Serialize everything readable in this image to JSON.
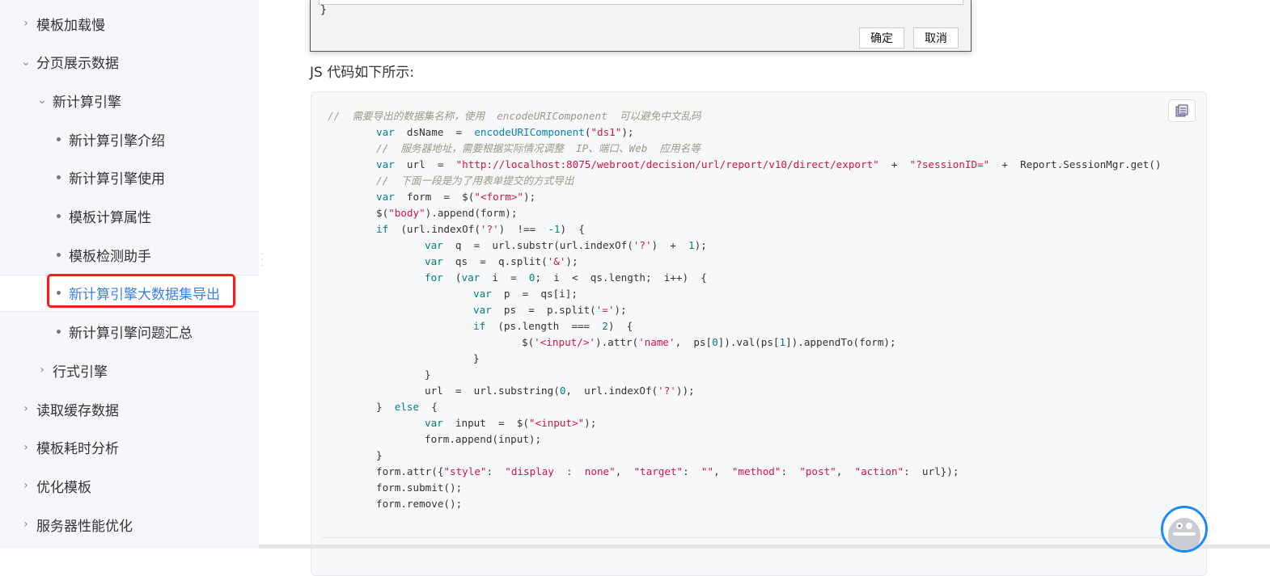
{
  "sidebar": {
    "items": [
      {
        "label": "模板加载慢",
        "level": 0,
        "type": "collapsed"
      },
      {
        "label": "分页展示数据",
        "level": 0,
        "type": "expanded"
      },
      {
        "label": "新计算引擎",
        "level": 1,
        "type": "expanded"
      },
      {
        "label": "新计算引擎介绍",
        "level": 2,
        "type": "leaf"
      },
      {
        "label": "新计算引擎使用",
        "level": 2,
        "type": "leaf"
      },
      {
        "label": "模板计算属性",
        "level": 2,
        "type": "leaf"
      },
      {
        "label": "模板检测助手",
        "level": 2,
        "type": "leaf"
      },
      {
        "label": "新计算引擎大数据集导出",
        "level": 2,
        "type": "leaf",
        "active": true
      },
      {
        "label": "新计算引擎问题汇总",
        "level": 2,
        "type": "leaf"
      },
      {
        "label": "行式引擎",
        "level": 1,
        "type": "collapsed"
      },
      {
        "label": "读取缓存数据",
        "level": 0,
        "type": "collapsed"
      },
      {
        "label": "模板耗时分析",
        "level": 0,
        "type": "collapsed"
      },
      {
        "label": "优化模板",
        "level": 0,
        "type": "collapsed"
      },
      {
        "label": "服务器性能优化",
        "level": 0,
        "type": "collapsed"
      }
    ]
  },
  "dialog": {
    "brace": "}",
    "ok_label": "确定",
    "cancel_label": "取消"
  },
  "content": {
    "js_label": "JS 代码如下所示:"
  },
  "colors": {
    "accent": "#3d7fe0",
    "highlight_box": "#ff1a1a",
    "keyword": "#008080",
    "string": "#dd1144",
    "comment": "#999988",
    "function": "#0086b3"
  },
  "code": [
    {
      "indent": 0,
      "tokens": [
        [
          "c",
          "//  需要导出的数据集名称，使用  encodeURIComponent  可以避免中文乱码"
        ]
      ]
    },
    {
      "indent": 1,
      "tokens": [
        [
          "k",
          "var"
        ],
        [
          "p",
          "  dsName  =  "
        ],
        [
          "f",
          "encodeURIComponent"
        ],
        [
          "p",
          "("
        ],
        [
          "s",
          "\"ds1\""
        ],
        [
          "p",
          ");"
        ]
      ]
    },
    {
      "indent": 1,
      "tokens": [
        [
          "c",
          "//  服务器地址，需要根据实际情况调整  IP、端口、Web  应用名等"
        ]
      ]
    },
    {
      "indent": 1,
      "tokens": [
        [
          "k",
          "var"
        ],
        [
          "p",
          "  url  =  "
        ],
        [
          "s",
          "\"http://localhost:8075/webroot/decision/url/report/v10/direct/export\""
        ],
        [
          "p",
          "  +  "
        ],
        [
          "s",
          "\"?sessionID=\""
        ],
        [
          "p",
          "  +  Report.SessionMgr.get()"
        ]
      ]
    },
    {
      "indent": 1,
      "tokens": [
        [
          "c",
          "//  下面一段是为了用表单提交的方式导出"
        ]
      ]
    },
    {
      "indent": 1,
      "tokens": [
        [
          "k",
          "var"
        ],
        [
          "p",
          "  form  =  $("
        ],
        [
          "s",
          "\"<form>\""
        ],
        [
          "p",
          ");"
        ]
      ]
    },
    {
      "indent": 1,
      "tokens": [
        [
          "p",
          "$("
        ],
        [
          "s",
          "\"body\""
        ],
        [
          "p",
          ").append(form);"
        ]
      ]
    },
    {
      "indent": 1,
      "tokens": [
        [
          "k",
          "if"
        ],
        [
          "p",
          "  (url.indexOf("
        ],
        [
          "s",
          "'?'"
        ],
        [
          "p",
          ")  !==  "
        ],
        [
          "n",
          "-1"
        ],
        [
          "p",
          ")  {"
        ]
      ]
    },
    {
      "indent": 2,
      "tokens": [
        [
          "k",
          "var"
        ],
        [
          "p",
          "  q  =  url.substr(url.indexOf("
        ],
        [
          "s",
          "'?'"
        ],
        [
          "p",
          ")  +  "
        ],
        [
          "n",
          "1"
        ],
        [
          "p",
          ");"
        ]
      ]
    },
    {
      "indent": 2,
      "tokens": [
        [
          "k",
          "var"
        ],
        [
          "p",
          "  qs  =  q.split("
        ],
        [
          "s",
          "'&'"
        ],
        [
          "p",
          ");"
        ]
      ]
    },
    {
      "indent": 2,
      "tokens": [
        [
          "k",
          "for"
        ],
        [
          "p",
          "  ("
        ],
        [
          "k",
          "var"
        ],
        [
          "p",
          "  i  =  "
        ],
        [
          "n",
          "0"
        ],
        [
          "p",
          ";  i  <  qs.length;  i++)  {"
        ]
      ]
    },
    {
      "indent": 3,
      "tokens": [
        [
          "k",
          "var"
        ],
        [
          "p",
          "  p  =  qs[i];"
        ]
      ]
    },
    {
      "indent": 3,
      "tokens": [
        [
          "k",
          "var"
        ],
        [
          "p",
          "  ps  =  p.split("
        ],
        [
          "s",
          "'='"
        ],
        [
          "p",
          ");"
        ]
      ]
    },
    {
      "indent": 3,
      "tokens": [
        [
          "k",
          "if"
        ],
        [
          "p",
          "  (ps.length  ===  "
        ],
        [
          "n",
          "2"
        ],
        [
          "p",
          ")  {"
        ]
      ]
    },
    {
      "indent": 4,
      "tokens": [
        [
          "p",
          "$("
        ],
        [
          "s",
          "'<input/>'"
        ],
        [
          "p",
          ").attr("
        ],
        [
          "s",
          "'name'"
        ],
        [
          "p",
          ",  ps["
        ],
        [
          "n",
          "0"
        ],
        [
          "p",
          "]).val(ps["
        ],
        [
          "n",
          "1"
        ],
        [
          "p",
          "]).appendTo(form);"
        ]
      ]
    },
    {
      "indent": 3,
      "tokens": [
        [
          "p",
          "}"
        ]
      ]
    },
    {
      "indent": 2,
      "tokens": [
        [
          "p",
          "}"
        ]
      ]
    },
    {
      "indent": 2,
      "tokens": [
        [
          "p",
          "url  =  url.substring("
        ],
        [
          "n",
          "0"
        ],
        [
          "p",
          ",  url.indexOf("
        ],
        [
          "s",
          "'?'"
        ],
        [
          "p",
          "));"
        ]
      ]
    },
    {
      "indent": 1,
      "tokens": [
        [
          "p",
          "}  "
        ],
        [
          "k",
          "else"
        ],
        [
          "p",
          "  {"
        ]
      ]
    },
    {
      "indent": 2,
      "tokens": [
        [
          "k",
          "var"
        ],
        [
          "p",
          "  input  =  $("
        ],
        [
          "s",
          "\"<input>\""
        ],
        [
          "p",
          ");"
        ]
      ]
    },
    {
      "indent": 2,
      "tokens": [
        [
          "p",
          "form.append(input);"
        ]
      ]
    },
    {
      "indent": 1,
      "tokens": [
        [
          "p",
          "}"
        ]
      ]
    },
    {
      "indent": 1,
      "tokens": [
        [
          "p",
          "form.attr({"
        ],
        [
          "s",
          "\"style\""
        ],
        [
          "p",
          ":  "
        ],
        [
          "s",
          "\"display  :  none\""
        ],
        [
          "p",
          ",  "
        ],
        [
          "s",
          "\"target\""
        ],
        [
          "p",
          ":  "
        ],
        [
          "s",
          "\"\""
        ],
        [
          "p",
          ",  "
        ],
        [
          "s",
          "\"method\""
        ],
        [
          "p",
          ":  "
        ],
        [
          "s",
          "\"post\""
        ],
        [
          "p",
          ",  "
        ],
        [
          "s",
          "\"action\""
        ],
        [
          "p",
          ":  url});"
        ]
      ]
    },
    {
      "indent": 1,
      "tokens": [
        [
          "p",
          "form.submit();"
        ]
      ]
    },
    {
      "indent": 1,
      "tokens": [
        [
          "p",
          "form.remove();"
        ]
      ]
    }
  ]
}
